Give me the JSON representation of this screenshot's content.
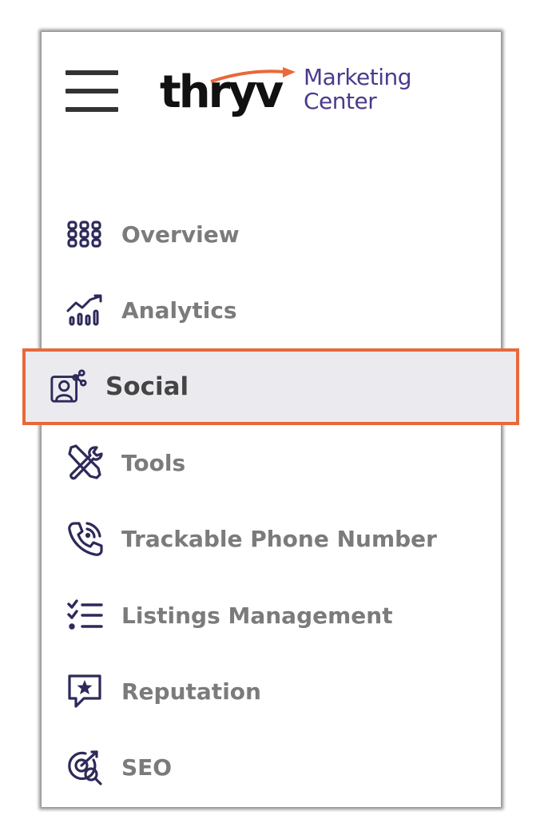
{
  "app": {
    "logo_word": "thryv",
    "logo_subtitle_line1": "Marketing",
    "logo_subtitle_line2": "Center",
    "brand_color": "#4b3a8c",
    "accent_color": "#e8693a"
  },
  "menu": {
    "hamburger_icon": "hamburger-icon"
  },
  "nav": {
    "items": [
      {
        "label": "Overview",
        "icon": "grid-icon"
      },
      {
        "label": "Analytics",
        "icon": "analytics-chart-icon"
      },
      {
        "label": "Social",
        "icon": "social-share-icon",
        "active": true
      },
      {
        "label": "Tools",
        "icon": "tools-icon"
      },
      {
        "label": "Trackable Phone Number",
        "icon": "phone-signal-icon"
      },
      {
        "label": "Listings Management",
        "icon": "checklist-icon"
      },
      {
        "label": "Reputation",
        "icon": "star-speech-bubble-icon"
      },
      {
        "label": "SEO",
        "icon": "target-search-icon"
      }
    ]
  }
}
